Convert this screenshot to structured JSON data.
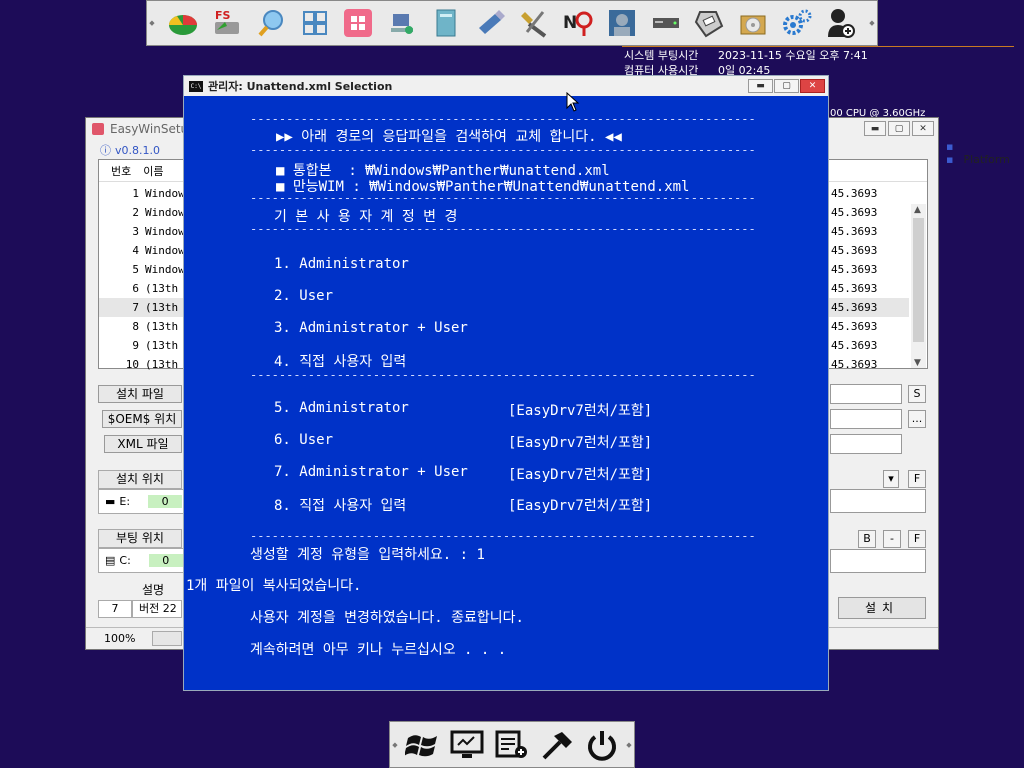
{
  "toolbar": {
    "icons": [
      "partition-tool-icon",
      "fs-drive-icon",
      "search-assist-icon",
      "tiles-icon",
      "windows-logo-icon",
      "network-pc-icon",
      "book-icon",
      "usb-stick-icon",
      "tools-icon",
      "no-text-icon",
      "user-photo-icon",
      "hard-drive-icon",
      "floppy-icon",
      "disc-box-icon",
      "gears-icon",
      "add-user-icon"
    ]
  },
  "sysinfo": {
    "boot_label": "시스템 부팅시간",
    "boot_value": "2023-11-15 수요일 오후 7:41",
    "use_label": "컴퓨터 사용시간",
    "use_value": "0일 02:45",
    "cpu": "00 CPU @ 3.60GHz"
  },
  "back_window": {
    "title": "EasyWinSetu",
    "version": "v0.8.1.0",
    "platform": "Platform",
    "headers": {
      "num": "번호",
      "name": "이름"
    },
    "rows": [
      {
        "num": "1",
        "name": "Window",
        "value": "45.3693"
      },
      {
        "num": "2",
        "name": "Window",
        "value": "45.3693"
      },
      {
        "num": "3",
        "name": "Window",
        "value": "45.3693"
      },
      {
        "num": "4",
        "name": "Window",
        "value": "45.3693"
      },
      {
        "num": "5",
        "name": "Window",
        "value": "45.3693"
      },
      {
        "num": "6",
        "name": "(13th",
        "value": "45.3693"
      },
      {
        "num": "7",
        "name": "(13th",
        "value": "45.3693"
      },
      {
        "num": "8",
        "name": "(13th",
        "value": "45.3693"
      },
      {
        "num": "9",
        "name": "(13th",
        "value": "45.3693"
      },
      {
        "num": "10",
        "name": "(13th",
        "value": "45.3693"
      }
    ],
    "install_file": "설치 파일",
    "oem_path": "$OEM$ 위치",
    "xml_file": "XML 파일",
    "install_location": "설치 위치",
    "install_drive": "E:",
    "install_drive_num": "0",
    "boot_location": "부팅 위치",
    "boot_drive": "C:",
    "boot_drive_num": "0",
    "description": "설명",
    "edition_num": "7",
    "edition_label": "버전 22",
    "install_button": "설치",
    "btn_s": "S",
    "btn_dots": "...",
    "btn_f": "F",
    "btn_b": "B",
    "btn_minus": "-",
    "btn_f2": "F",
    "zoom": "100%"
  },
  "console": {
    "title": "관리자: Unattend.xml Selection",
    "icon_text": "C:\\",
    "dash_line": "----------------------------------------------------------------------",
    "header": "▶▶ 아래 경로의 응답파일을 검색하여 교체 합니다. ◀◀",
    "path1": "■ 통합본  : ₩Windows₩Panther₩unattend.xml",
    "path2": "■ 만능WIM : ₩Windows₩Panther₩Unattend₩unattend.xml",
    "section": "기 본 사 용 자 계 정 변 경",
    "opt1": "1. Administrator",
    "opt2": "2. User",
    "opt3": "3. Administrator + User",
    "opt4": "4. 직접 사용자 입력",
    "opt5": "5. Administrator",
    "opt6": "6. User",
    "opt7": "7. Administrator + User",
    "opt8": "8. 직접 사용자 입력",
    "tag": "[EasyDrv7런처/포함]",
    "prompt": "생성할 계정 유형을 입력하세요. : 1",
    "copied": "1개 파일이 복사되었습니다.",
    "changed": "사용자 계정을 변경하였습니다. 종료합니다.",
    "pause": "계속하려면 아무 키나 누르십시오 . . ."
  },
  "taskbar": {
    "icons": [
      "windows-flag-icon",
      "monitor-icon",
      "task-list-icon",
      "hammer-icon",
      "power-icon"
    ]
  },
  "colors": {
    "desktop": "#1d0c58",
    "console_bg": "#0032c8"
  }
}
